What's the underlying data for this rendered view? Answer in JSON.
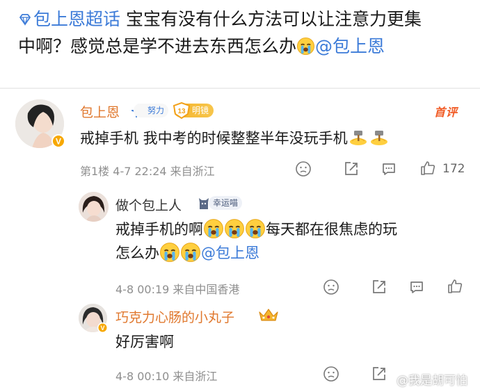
{
  "post": {
    "topic": "包上恩超话",
    "text_line1": " 宝宝有没有什么方法可以让注意力更集",
    "text_line2": "中啊？感觉总是学不进去东西怎么办",
    "mention": "@包上恩"
  },
  "comment": {
    "username": "包上恩",
    "effort_badge": "努力",
    "level_badge": "明镜",
    "level_number": "13",
    "first_tag": "首评",
    "text": "戒掉手机 我中考的时候整整半年没玩手机",
    "meta": "第1楼 4-7 22:24 来自浙江",
    "likes": "172"
  },
  "reply1": {
    "username": "做个包上人",
    "badge": "幸运喵",
    "text_line1": "戒掉手机的啊",
    "text_line1_tail": "每天都在很焦虑的玩",
    "text_line2": "怎么办",
    "mention": "@包上恩",
    "meta": "4-8 00:19 来自中国香港"
  },
  "reply2": {
    "username": "巧克力心肠的小丸子",
    "text": "好厉害啊",
    "meta": "4-8 00:10 来自浙江"
  },
  "watermark": "@我是胡可怕",
  "colors": {
    "link": "#3c7bd8",
    "orange_name": "#e0782e",
    "first_tag": "#f15a24",
    "meta_gray": "#8f8f8f"
  }
}
